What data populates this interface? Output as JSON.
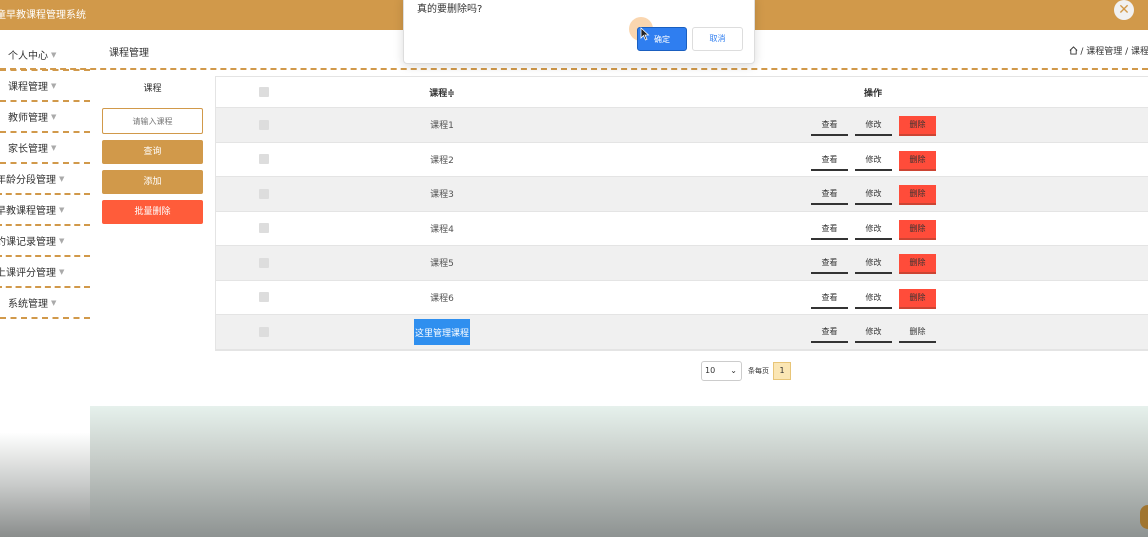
{
  "app": {
    "title": "童早教课程管理系统",
    "close_icon": "close-icon"
  },
  "sidebar": {
    "items": [
      {
        "label": "个人中心"
      },
      {
        "label": "课程管理"
      },
      {
        "label": "教师管理"
      },
      {
        "label": "家长管理"
      },
      {
        "label": "年龄分段管理"
      },
      {
        "label": "早教课程管理"
      },
      {
        "label": "约课记录管理"
      },
      {
        "label": "上课评分管理"
      },
      {
        "label": "系统管理"
      }
    ]
  },
  "header": {
    "page_title": "课程管理",
    "breadcrumb": "/ 课程管理 / 课程列"
  },
  "search": {
    "label": "课程",
    "placeholder": "请输入课程",
    "search_label": "查询",
    "add_label": "添加",
    "batch_delete_label": "批量删除"
  },
  "table": {
    "columns": {
      "name": "课程≑",
      "ops": "操作"
    },
    "rows": [
      {
        "name": "课程1",
        "view": "查看",
        "edit": "修改",
        "delete": "删除"
      },
      {
        "name": "课程2",
        "view": "查看",
        "edit": "修改",
        "delete": "删除"
      },
      {
        "name": "课程3",
        "view": "查看",
        "edit": "修改",
        "delete": "删除"
      },
      {
        "name": "课程4",
        "view": "查看",
        "edit": "修改",
        "delete": "删除"
      },
      {
        "name": "课程5",
        "view": "查看",
        "edit": "修改",
        "delete": "删除"
      },
      {
        "name": "课程6",
        "view": "查看",
        "edit": "修改",
        "delete": "删除"
      },
      {
        "name": "这里管理课程",
        "view": "查看",
        "edit": "修改",
        "delete": "删除"
      }
    ]
  },
  "pagination": {
    "page_size": "10",
    "per_page_label": "条每页",
    "current_page": "1"
  },
  "dialog": {
    "message": "真的要删除吗?",
    "ok_label": "确定",
    "cancel_label": "取消"
  },
  "colors": {
    "brand": "#d1994a",
    "danger": "#ff4c3a",
    "primary": "#2f7ef0"
  }
}
